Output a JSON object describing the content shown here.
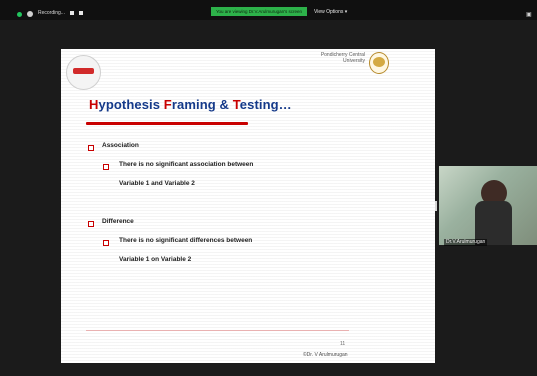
{
  "topbar": {
    "recording_label": "Recording...",
    "sharing_banner": "You are viewing Dr.V.Arulmurugan's screen",
    "view_options": "View Options",
    "icons": {
      "record": "record-icon",
      "pause": "pause-icon",
      "stop": "stop-icon",
      "window": "window-icon"
    }
  },
  "slide": {
    "university_name": "Pondicherry Central University",
    "title_parts": [
      "H",
      "ypothesis ",
      "F",
      "raming & ",
      "T",
      "esting…"
    ],
    "sections": [
      {
        "heading": "Association",
        "lines": [
          "There is no significant association between",
          "Variable 1 and Variable 2"
        ]
      },
      {
        "heading": "Difference",
        "lines": [
          "There is no significant differences between",
          "Variable 1 on  Variable 2"
        ]
      }
    ],
    "page_number": "11",
    "footer_author": "©Dr. V Arulmurugan"
  },
  "participant": {
    "name": "Dr.V.Arulmurugan"
  },
  "colors": {
    "accent_red": "#c80000",
    "title_blue": "#153a8a",
    "share_green": "#2db24a"
  }
}
